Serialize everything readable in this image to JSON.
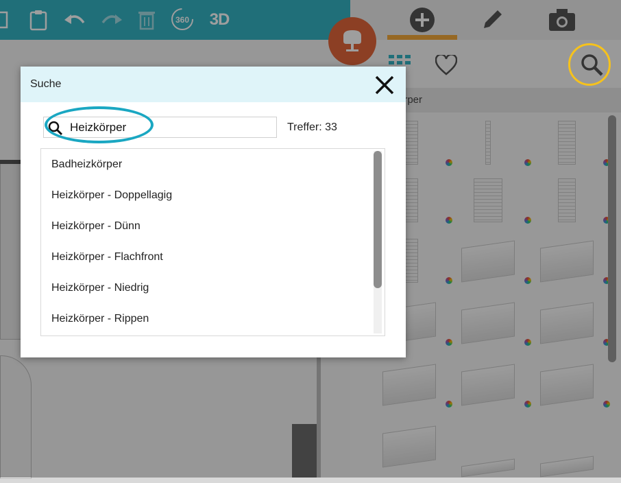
{
  "toolbar": {
    "btn_360_label": "360",
    "btn_3d_label": "3D"
  },
  "right_panel": {
    "category_label": "örper"
  },
  "dialog": {
    "title": "Suche",
    "search_value": "Heizkörper",
    "hits_label": "Treffer: 33",
    "results": [
      "Badheizkörper",
      "Heizkörper - Doppellagig",
      "Heizkörper - Dünn",
      "Heizkörper - Flachfront",
      "Heizkörper - Niedrig",
      "Heizkörper - Rippen"
    ]
  },
  "colors": {
    "toolbar": "#35b3c4",
    "accent_orange": "#e2673a",
    "active_tab": "#f2a93b",
    "search_highlight": "#f6c21c",
    "input_highlight": "#1aa7c2"
  }
}
